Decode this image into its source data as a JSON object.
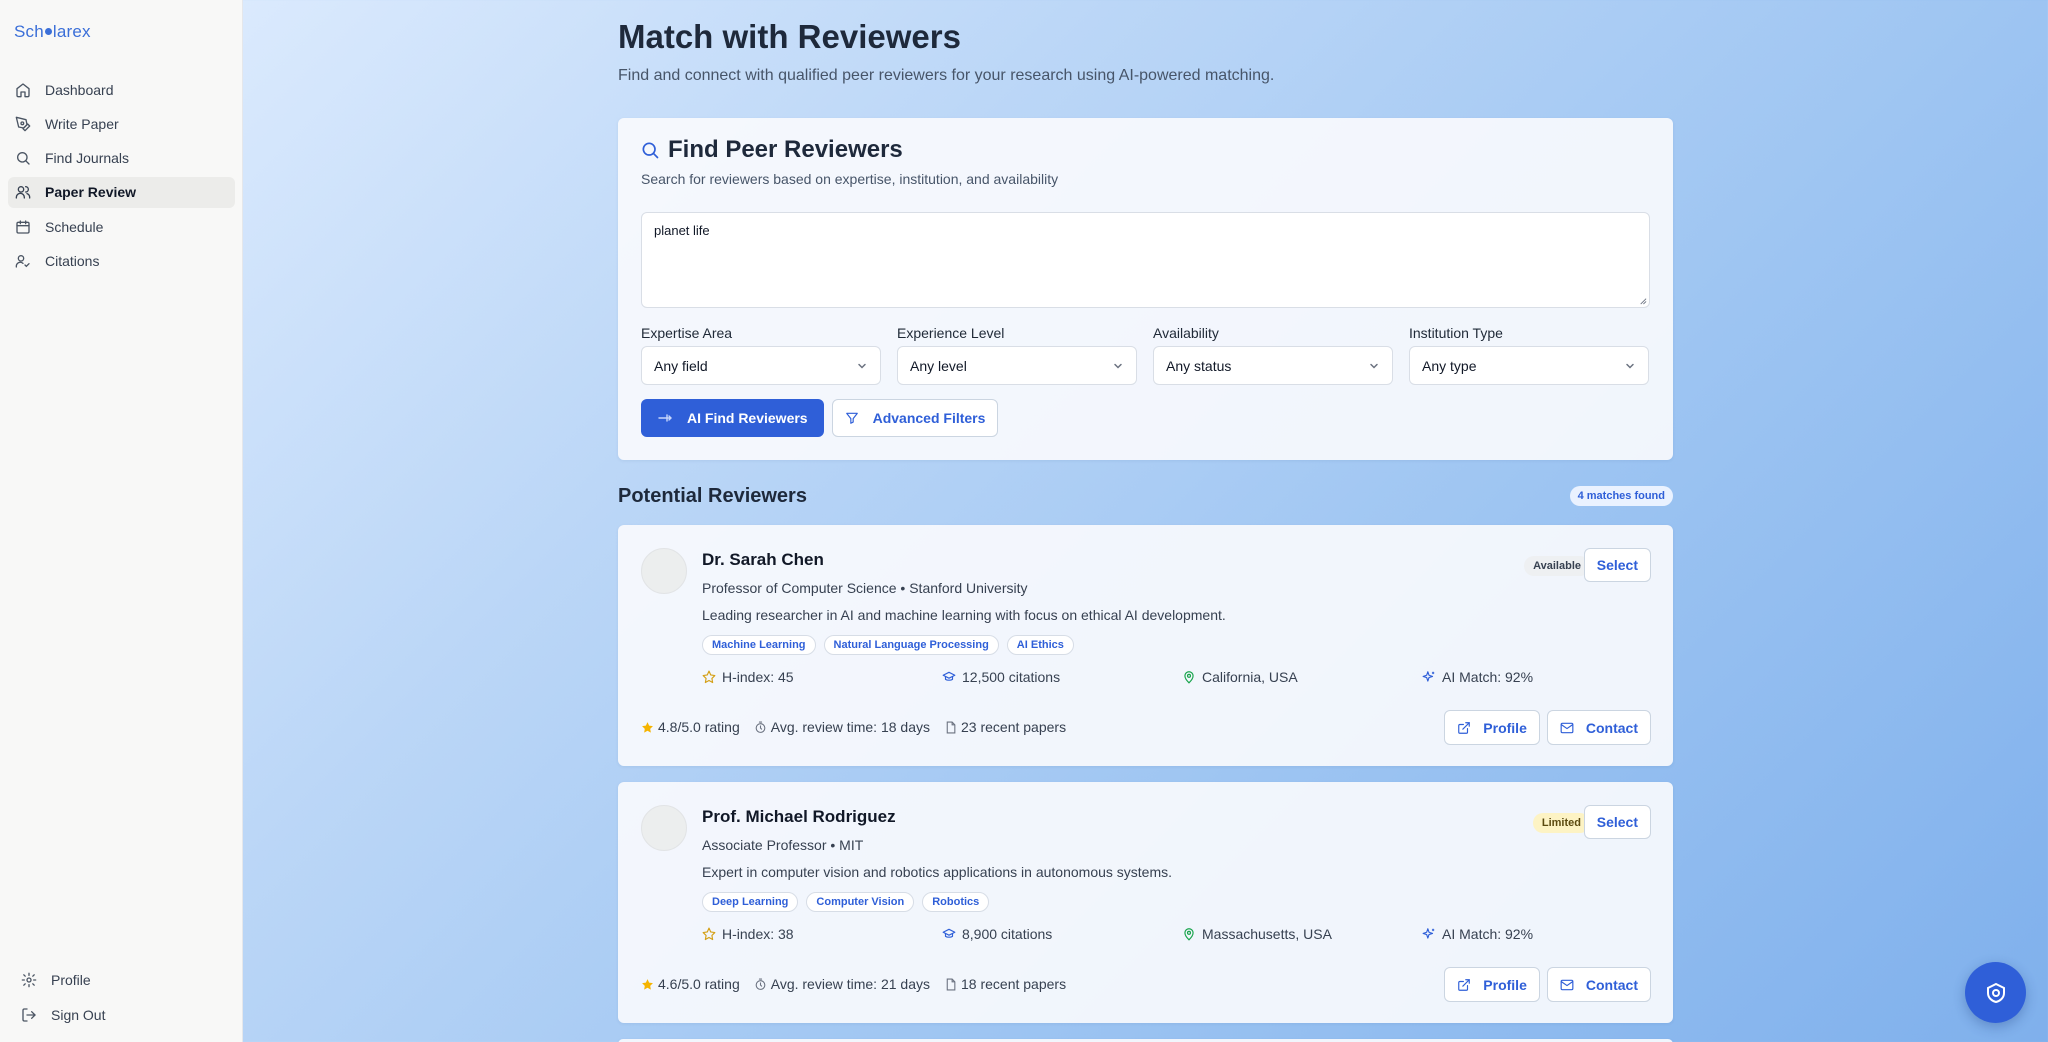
{
  "app": {
    "logo_prefix": "Sch",
    "logo_suffix": "larex"
  },
  "sidebar": {
    "items": [
      {
        "label": "Dashboard",
        "icon": "home-icon"
      },
      {
        "label": "Write Paper",
        "icon": "pen-icon"
      },
      {
        "label": "Find Journals",
        "icon": "search-icon"
      },
      {
        "label": "Paper Review",
        "icon": "users-icon",
        "active": true
      },
      {
        "label": "Schedule",
        "icon": "calendar-icon"
      },
      {
        "label": "Citations",
        "icon": "user-check-icon"
      }
    ],
    "bottom": [
      {
        "label": "Profile",
        "icon": "gear-icon"
      },
      {
        "label": "Sign Out",
        "icon": "sign-out-icon"
      }
    ]
  },
  "page": {
    "title": "Match with Reviewers",
    "subtitle": "Find and connect with qualified peer reviewers for your research using AI-powered matching."
  },
  "search": {
    "title": "Find Peer Reviewers",
    "description": "Search for reviewers based on expertise, institution, and availability",
    "query": "planet life",
    "filters": [
      {
        "label": "Expertise Area",
        "value": "Any field"
      },
      {
        "label": "Experience Level",
        "value": "Any level"
      },
      {
        "label": "Availability",
        "value": "Any status"
      },
      {
        "label": "Institution Type",
        "value": "Any type"
      }
    ],
    "primary_button": "AI Find Reviewers",
    "secondary_button": "Advanced Filters"
  },
  "results": {
    "title": "Potential Reviewers",
    "count_label": "4 matches found",
    "reviewers": [
      {
        "name": "Dr. Sarah Chen",
        "title": "Professor of Computer Science • Stanford University",
        "bio": "Leading researcher in AI and machine learning with focus on ethical AI development.",
        "tags": [
          "Machine Learning",
          "Natural Language Processing",
          "AI Ethics"
        ],
        "h_index": "H-index: 45",
        "citations": "12,500 citations",
        "location": "California, USA",
        "ai_match": "AI Match: 92%",
        "status": "Available",
        "status_color": "#eef0f2",
        "select_label": "Select",
        "rating": "4.8/5.0 rating",
        "review_time": "Avg. review time: 18 days",
        "recent_papers": "23 recent papers",
        "profile_label": "Profile",
        "contact_label": "Contact"
      },
      {
        "name": "Prof. Michael Rodriguez",
        "title": "Associate Professor • MIT",
        "bio": "Expert in computer vision and robotics applications in autonomous systems.",
        "tags": [
          "Deep Learning",
          "Computer Vision",
          "Robotics"
        ],
        "h_index": "H-index: 38",
        "citations": "8,900 citations",
        "location": "Massachusetts, USA",
        "ai_match": "AI Match: 92%",
        "status": "Limited",
        "status_color": "#fdf3c4",
        "select_label": "Select",
        "rating": "4.6/5.0 rating",
        "review_time": "Avg. review time: 21 days",
        "recent_papers": "18 recent papers",
        "profile_label": "Profile",
        "contact_label": "Contact"
      }
    ]
  },
  "colors": {
    "accent": "#2f5fd8",
    "sidebar_bg": "#f8f8f7"
  }
}
